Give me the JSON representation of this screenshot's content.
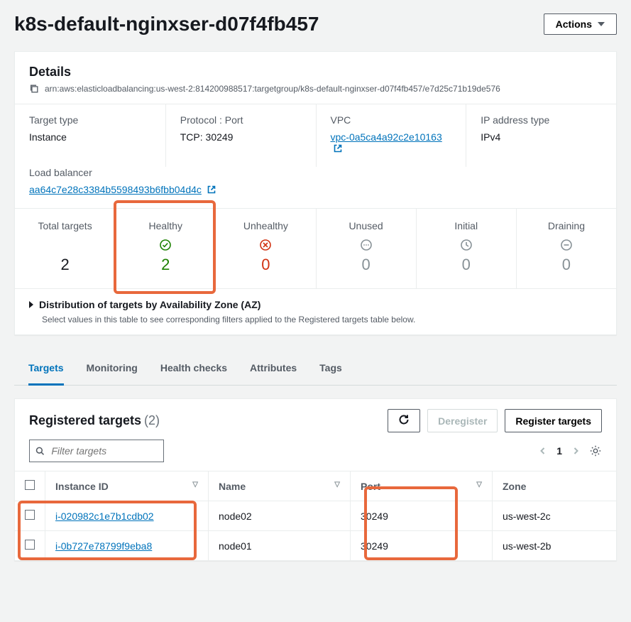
{
  "header": {
    "title": "k8s-default-nginxser-d07f4fb457",
    "actions_label": "Actions"
  },
  "details": {
    "section_title": "Details",
    "arn": "arn:aws:elasticloadbalancing:us-west-2:814200988517:targetgroup/k8s-default-nginxser-d07f4fb457/e7d25c71b19de576",
    "target_type": {
      "label": "Target type",
      "value": "Instance"
    },
    "protocol_port": {
      "label": "Protocol : Port",
      "value": "TCP: 30249"
    },
    "vpc": {
      "label": "VPC",
      "value": "vpc-0a5ca4a92c2e10163"
    },
    "ip_type": {
      "label": "IP address type",
      "value": "IPv4"
    },
    "load_balancer": {
      "label": "Load balancer",
      "value": "aa64c7e28c3384b5598493b6fbb04d4c"
    }
  },
  "stats": {
    "total": {
      "label": "Total targets",
      "value": "2"
    },
    "healthy": {
      "label": "Healthy",
      "value": "2"
    },
    "unhealthy": {
      "label": "Unhealthy",
      "value": "0"
    },
    "unused": {
      "label": "Unused",
      "value": "0"
    },
    "initial": {
      "label": "Initial",
      "value": "0"
    },
    "draining": {
      "label": "Draining",
      "value": "0"
    }
  },
  "distribution": {
    "title": "Distribution of targets by Availability Zone (AZ)",
    "subtitle": "Select values in this table to see corresponding filters applied to the Registered targets table below."
  },
  "tabs": {
    "targets": "Targets",
    "monitoring": "Monitoring",
    "health": "Health checks",
    "attributes": "Attributes",
    "tags": "Tags"
  },
  "targets": {
    "title": "Registered targets",
    "count": "(2)",
    "deregister": "Deregister",
    "register": "Register targets",
    "filter_placeholder": "Filter targets",
    "page": "1",
    "columns": {
      "instance": "Instance ID",
      "name": "Name",
      "port": "Port",
      "zone": "Zone"
    },
    "rows": [
      {
        "instance": "i-020982c1e7b1cdb02",
        "name": "node02",
        "port": "30249",
        "zone": "us-west-2c"
      },
      {
        "instance": "i-0b727e78799f9eba8",
        "name": "node01",
        "port": "30249",
        "zone": "us-west-2b"
      }
    ]
  }
}
